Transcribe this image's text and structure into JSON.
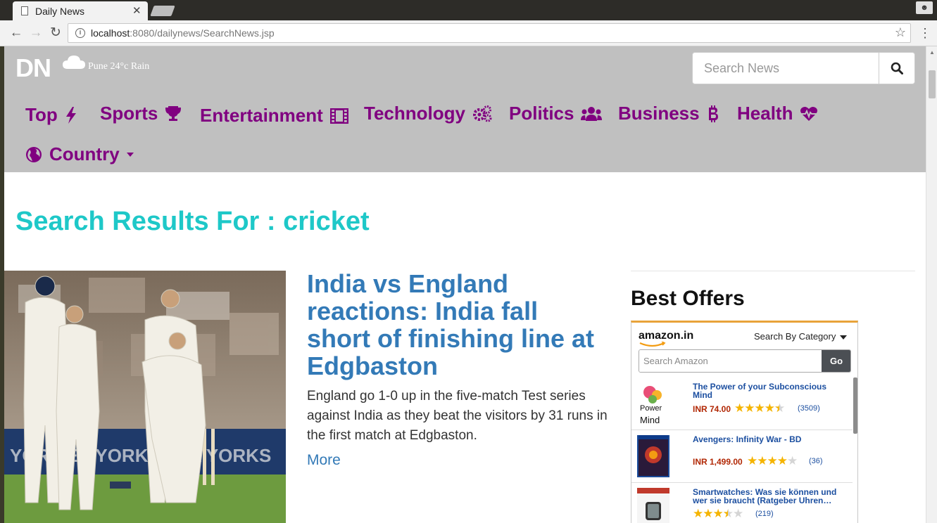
{
  "browser": {
    "tab_title": "Daily News",
    "tab_close": "✕",
    "url_host": "localhost",
    "url_rest": ":8080/dailynews/SearchNews.jsp"
  },
  "header": {
    "brand": "DN",
    "weather": "Pune 24°c Rain",
    "search_placeholder": "Search News"
  },
  "menu": [
    {
      "label": "Top",
      "icon": "bolt-icon"
    },
    {
      "label": "Sports",
      "icon": "trophy-icon"
    },
    {
      "label": "Entertainment",
      "icon": "film-icon"
    },
    {
      "label": "Technology",
      "icon": "gears-icon"
    },
    {
      "label": "Politics",
      "icon": "users-icon"
    },
    {
      "label": "Business",
      "icon": "bitcoin-icon"
    },
    {
      "label": "Health",
      "icon": "heartbeat-icon"
    },
    {
      "label": "Country",
      "icon": "globe-icon"
    }
  ],
  "results": {
    "heading": "Search Results For : cricket"
  },
  "article": {
    "title": "India vs England reactions: India fall short of finishing line at Edgbaston",
    "summary": "England go 1-0 up in the five-match Test series against India as they beat the visitors by 31 runs in the first match at Edgbaston.",
    "more_label": "More"
  },
  "offers": {
    "title": "Best Offers",
    "amazon_logo": "amazon.in",
    "category_label": "Search By Category",
    "search_placeholder": "Search Amazon",
    "go_label": "Go",
    "items": [
      {
        "title": "The Power of your Subconscious Mind",
        "price": "INR 74.00",
        "rating": 4.5,
        "count": "(3509)"
      },
      {
        "title": "Avengers: Infinity War - BD",
        "price": "INR 1,499.00",
        "rating": 4,
        "count": "(36)"
      },
      {
        "title": "Smartwatches: Was sie können und wer sie braucht (Ratgeber Uhren…",
        "price": "",
        "rating": 3.5,
        "count": "(219)"
      }
    ]
  },
  "colors": {
    "menu_purple": "#800080",
    "results_cyan": "#1ec8c8",
    "link_blue": "#337ab7",
    "navbar_gray": "#c0c0c0"
  }
}
